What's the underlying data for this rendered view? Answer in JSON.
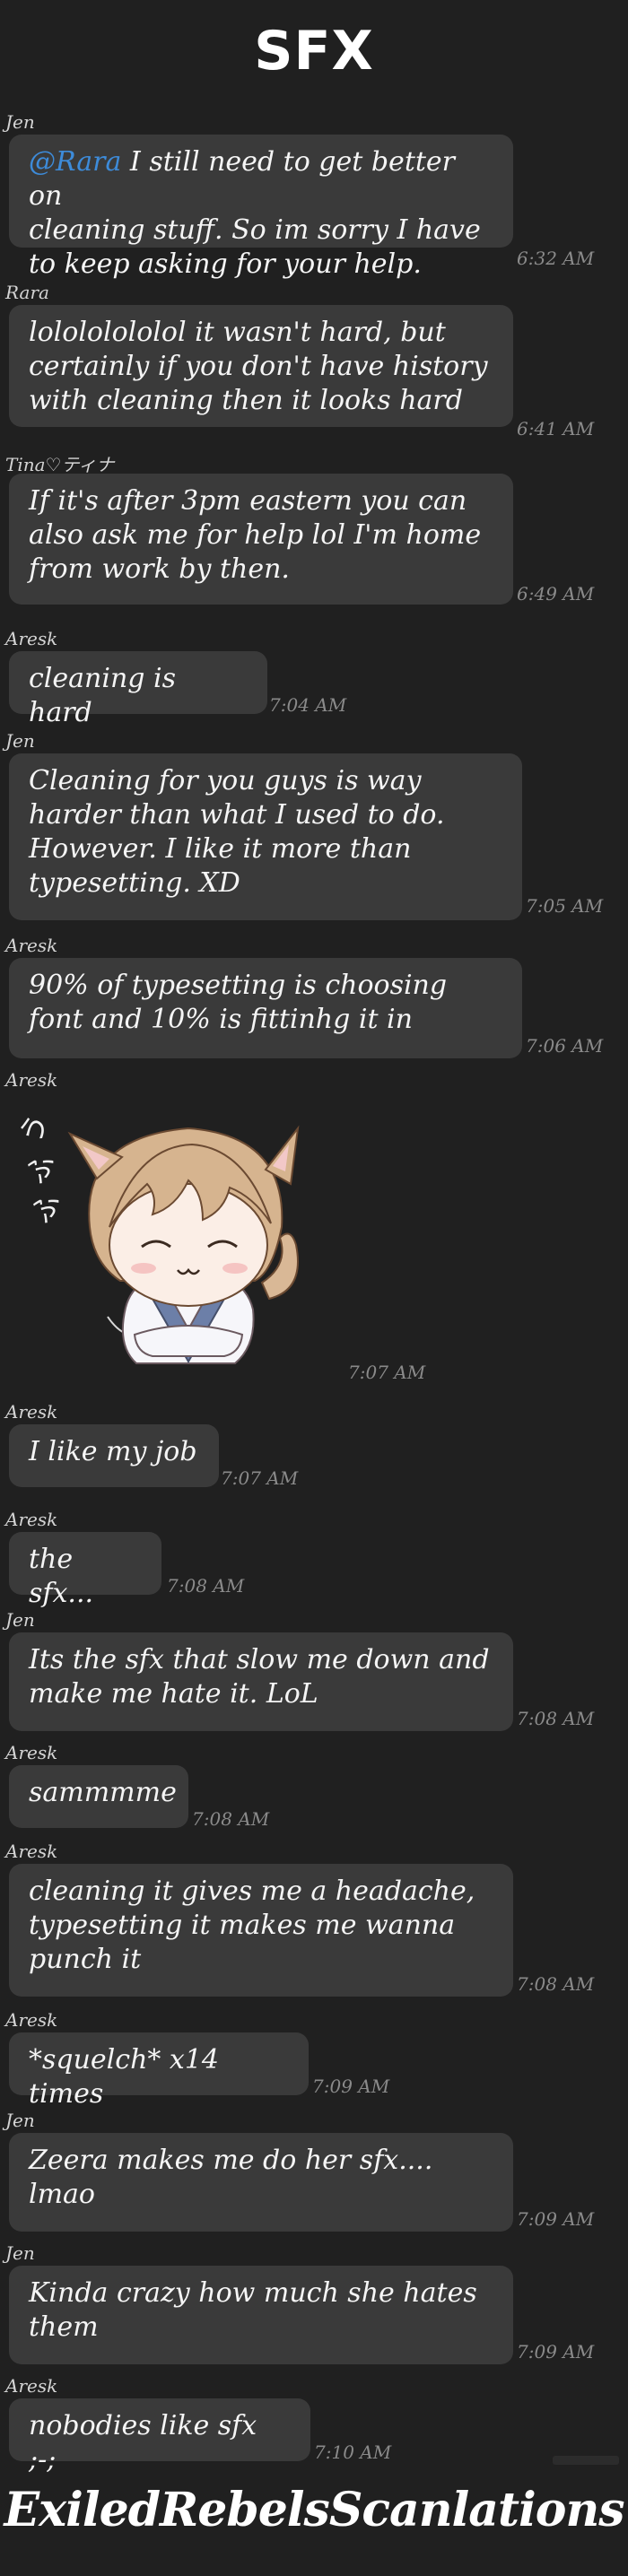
{
  "title": "SFX",
  "messages": [
    {
      "sender": "Jen",
      "mention": "@Rara",
      "text": " I still need to get better on\ncleaning stuff. So im sorry I have\nto keep asking for your help.",
      "time": "6:32 AM"
    },
    {
      "sender": "Rara",
      "text": "lolololololol it wasn't hard, but\ncertainly if you don't have history\nwith cleaning then it looks hard",
      "time": "6:41 AM"
    },
    {
      "sender": "Tina♡ティナ",
      "text": "If it's after 3pm eastern you can\nalso ask me for help lol I'm home\nfrom work by then.",
      "time": "6:49 AM"
    },
    {
      "sender": "Aresk",
      "text": "cleaning is hard",
      "time": "7:04 AM"
    },
    {
      "sender": "Jen",
      "text": "Cleaning for you guys is way\nharder than what I used to do.\nHowever. I like it more than\ntypesetting. XD",
      "time": "7:05 AM"
    },
    {
      "sender": "Aresk",
      "text": "90% of typesetting is choosing\nfont and 10% is fittinhg it in",
      "time": "7:06 AM"
    },
    {
      "sender": "Aresk",
      "sticker": "cat-boy-sticker",
      "sticker_text": "うふふ",
      "time": "7:07 AM"
    },
    {
      "sender": "Aresk",
      "text": "I like my job",
      "time": "7:07 AM"
    },
    {
      "sender": "Aresk",
      "text": "the sfx...",
      "time": "7:08 AM"
    },
    {
      "sender": "Jen",
      "text": "Its the sfx that slow me down and\nmake me hate it. LoL",
      "time": "7:08 AM"
    },
    {
      "sender": "Aresk",
      "text": "sammmme",
      "time": "7:08 AM"
    },
    {
      "sender": "Aresk",
      "text": "cleaning it gives me a headache,\ntypesetting it makes me wanna\npunch it",
      "time": "7:08 AM"
    },
    {
      "sender": "Aresk",
      "text": "*squelch* x14 times",
      "time": "7:09 AM"
    },
    {
      "sender": "Jen",
      "text": "Zeera makes me do her sfx....\nlmao",
      "time": "7:09 AM"
    },
    {
      "sender": "Jen",
      "text": "Kinda crazy how much she hates\nthem",
      "time": "7:09 AM"
    },
    {
      "sender": "Aresk",
      "text": "nobodies like sfx ;-;",
      "time": "7:10 AM"
    }
  ],
  "footer": "ExiledRebelsScanlations",
  "colors": {
    "background": "#202020",
    "bubble": "#3a3a3a",
    "mention": "#3d8bd9",
    "timestamp": "#8a8a8a"
  }
}
